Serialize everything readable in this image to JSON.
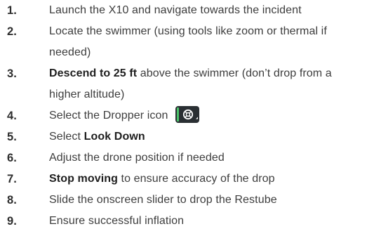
{
  "steps": [
    {
      "num": "1.",
      "parts": [
        {
          "t": "Launch the X10 and navigate towards the incident",
          "b": false
        }
      ]
    },
    {
      "num": "2.",
      "parts": [
        {
          "t": "Locate the swimmer (using tools like zoom or thermal if needed)",
          "b": false
        }
      ]
    },
    {
      "num": "3.",
      "parts": [
        {
          "t": "Descend to 25 ft",
          "b": true
        },
        {
          "t": " above the swimmer (don’t drop from a higher altitude)",
          "b": false
        }
      ]
    },
    {
      "num": "4.",
      "parts": [
        {
          "t": "Select the Dropper icon",
          "b": false
        }
      ],
      "icon": "dropper-icon"
    },
    {
      "num": "5.",
      "parts": [
        {
          "t": "Select ",
          "b": false
        },
        {
          "t": "Look Down",
          "b": true
        }
      ]
    },
    {
      "num": "6.",
      "parts": [
        {
          "t": "Adjust the drone position if needed",
          "b": false
        }
      ]
    },
    {
      "num": "7.",
      "parts": [
        {
          "t": "Stop moving",
          "b": true
        },
        {
          "t": " to ensure accuracy of the drop",
          "b": false
        }
      ]
    },
    {
      "num": "8.",
      "parts": [
        {
          "t": "Slide the onscreen slider to drop the Restube",
          "b": false
        }
      ]
    },
    {
      "num": "9.",
      "parts": [
        {
          "t": "Ensure successful inflation",
          "b": false
        }
      ]
    }
  ],
  "colors": {
    "text": "#3d3d3d",
    "bold": "#1e1e1e",
    "icon_bg": "#2a2f33",
    "icon_accent": "#4cc36a"
  }
}
